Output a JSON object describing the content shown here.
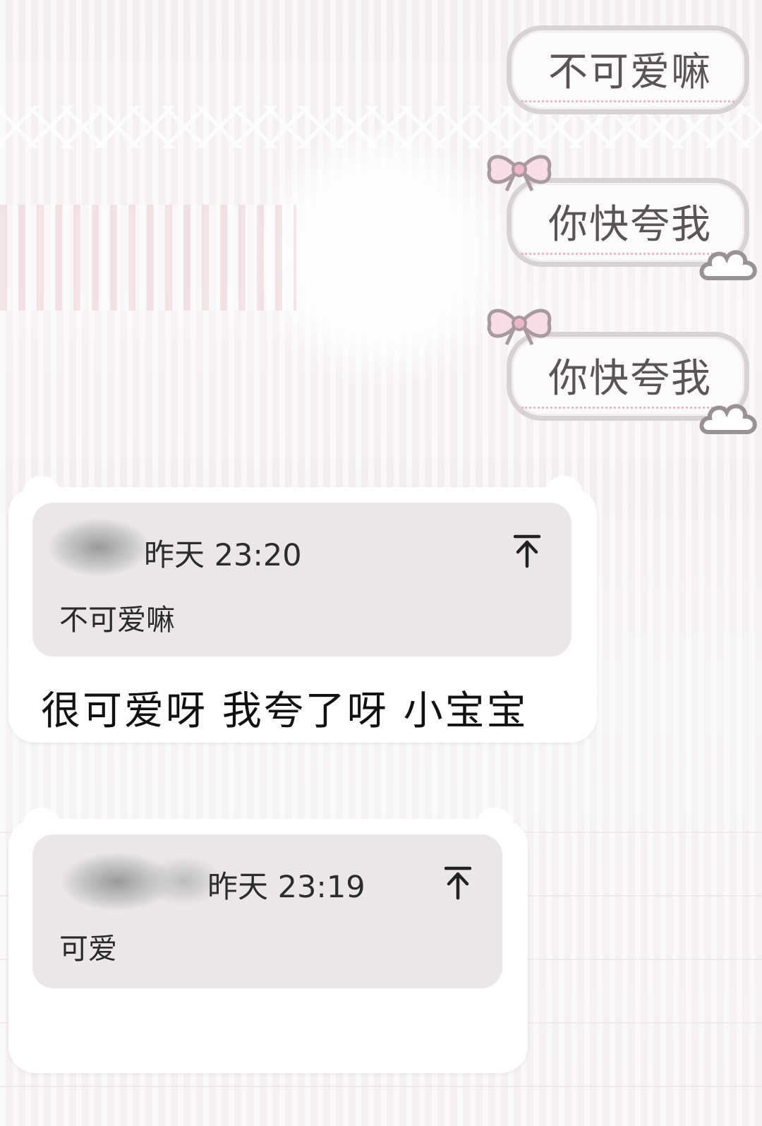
{
  "sent_messages": [
    {
      "text": "不可爱嘛"
    },
    {
      "text": "你快夸我"
    },
    {
      "text": "你快夸我"
    }
  ],
  "received_messages": [
    {
      "quote": {
        "time": "昨天 23:20",
        "text": "不可爱嘛"
      },
      "text": "很可爱呀 我夸了呀 小宝宝"
    },
    {
      "quote": {
        "time": "昨天 23:19",
        "text": "可爱"
      },
      "text": ""
    }
  ],
  "icons": {
    "jump": "arrow-up-to-line-icon",
    "decoration_bow": "bow-icon",
    "decoration_cloud": "cloud-icon"
  },
  "colors": {
    "sent_bubble_border": "#d9d2d4",
    "quote_background": "#ebe6ea",
    "bow_pink": "#e8b6c4"
  }
}
